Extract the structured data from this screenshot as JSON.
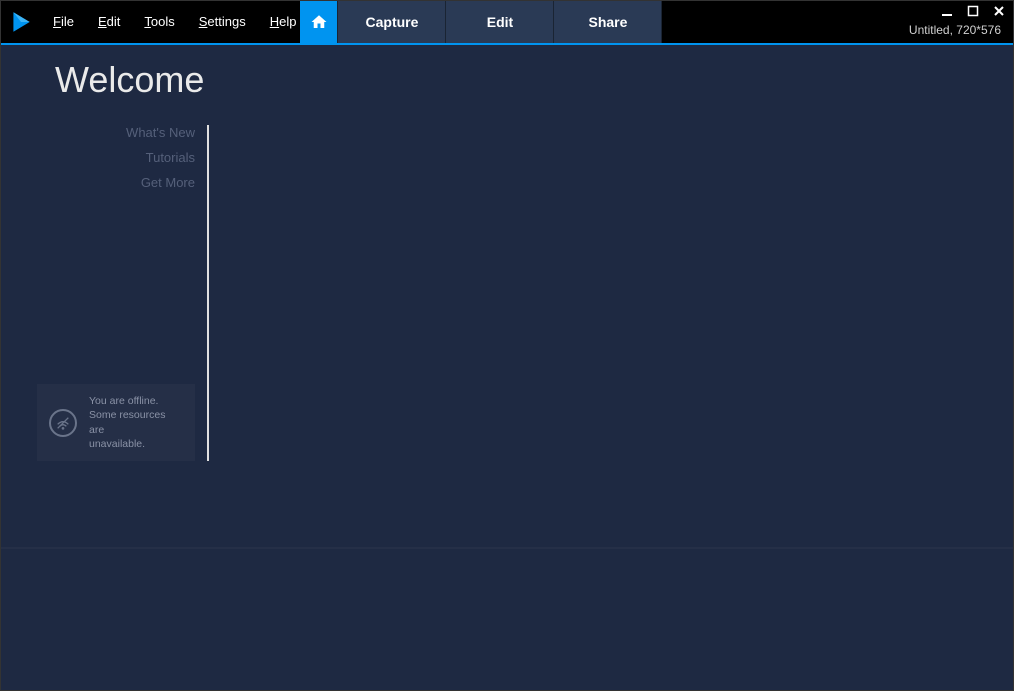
{
  "menu": {
    "file": "File",
    "edit": "Edit",
    "tools": "Tools",
    "settings": "Settings",
    "help": "Help"
  },
  "tabs": {
    "capture": "Capture",
    "edit": "Edit",
    "share": "Share"
  },
  "status": "Untitled, 720*576",
  "welcome": {
    "title": "Welcome"
  },
  "sidebar": {
    "whats_new": "What's New",
    "tutorials": "Tutorials",
    "get_more": "Get More"
  },
  "offline": {
    "line1": "You are offline.",
    "line2": "Some resources are",
    "line3": "unavailable."
  }
}
